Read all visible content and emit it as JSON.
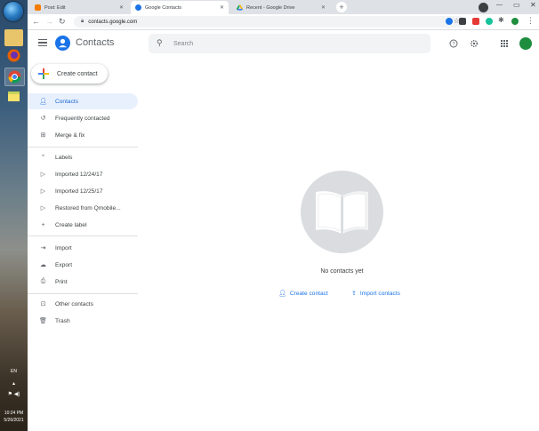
{
  "browser": {
    "tabs": [
      {
        "label": "Post: Edit",
        "favicon_color": "#f57c00"
      },
      {
        "label": "Google Contacts",
        "favicon_color": "#1a73e8"
      },
      {
        "label": "Recent - Google Drive",
        "favicon_color": "#0f9d58"
      }
    ],
    "new_tab_symbol": "+",
    "url": "contacts.google.com"
  },
  "taskbar": {
    "language": "EN",
    "time": "10:24 PM",
    "date": "5/26/2021"
  },
  "header": {
    "app_title": "Contacts",
    "search_placeholder": "Search"
  },
  "sidebar": {
    "create_label": "Create contact",
    "items_top": [
      {
        "label": "Contacts",
        "icon": "person-icon"
      },
      {
        "label": "Frequently contacted",
        "icon": "history-icon"
      },
      {
        "label": "Merge & fix",
        "icon": "merge-icon"
      }
    ],
    "labels_heading": "Labels",
    "labels": [
      {
        "label": "Imported 12/24/17"
      },
      {
        "label": "Imported 12/25/17"
      },
      {
        "label": "Restored from Qmobile..."
      }
    ],
    "create_label_item": "Create label",
    "items_io": [
      {
        "label": "Import"
      },
      {
        "label": "Export"
      },
      {
        "label": "Print"
      }
    ],
    "items_bottom": [
      {
        "label": "Other contacts"
      },
      {
        "label": "Trash"
      }
    ]
  },
  "main": {
    "empty_text": "No contacts yet",
    "create_link": "Create contact",
    "import_link": "Import contacts"
  }
}
